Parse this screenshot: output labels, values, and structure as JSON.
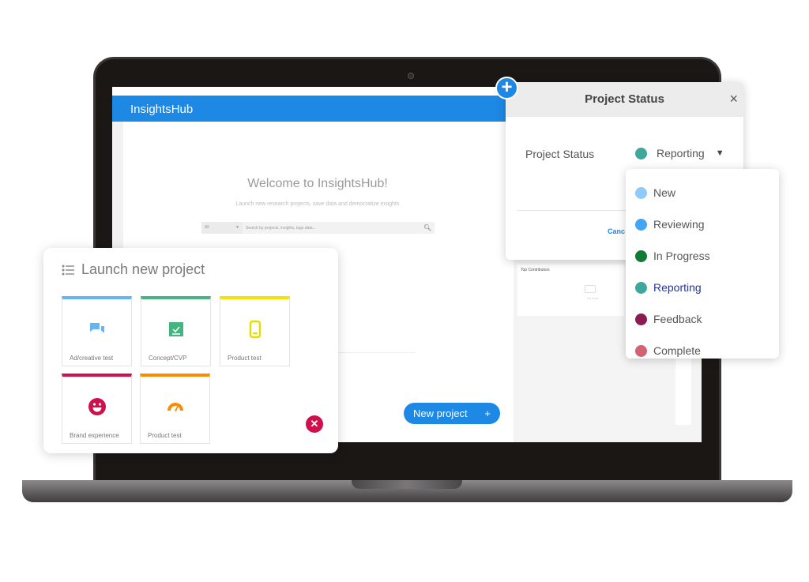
{
  "app": {
    "title": "InsightsHub",
    "welcome": "Welcome to InsightsHub!",
    "subtitle": "Launch new research projects, save data and democratize insights",
    "search": {
      "filter": "All",
      "placeholder": "Search by projects, insights, tags data..."
    },
    "top_contributors": {
      "title": "Top Contributors",
      "empty": "No Data"
    },
    "new_project_label": "New project",
    "new_project_icon": "+",
    "accent": "#1e88e5"
  },
  "launch": {
    "title": "Launch new project",
    "tiles": [
      {
        "label": "Ad/creative test",
        "color": "#64b5f6",
        "icon": "chat-bubbles-icon"
      },
      {
        "label": "Concept/CVP",
        "color": "#43b581",
        "icon": "checkbox-icon"
      },
      {
        "label": "Product test",
        "color": "#f0e400",
        "icon": "phone-icon"
      },
      {
        "label": "Brand experience",
        "color": "#d0104c",
        "icon": "smiley-icon"
      },
      {
        "label": "Product test",
        "color": "#fb8c00",
        "icon": "gauge-icon"
      }
    ],
    "close_icon": "✕"
  },
  "dialog": {
    "title": "Project Status",
    "close": "×",
    "field_label": "Project Status",
    "selected": "Reporting",
    "selected_color": "#3ea99a",
    "cancel": "Canc",
    "add_icon": "+"
  },
  "dropdown": {
    "options": [
      {
        "label": "New",
        "color": "#90caf9"
      },
      {
        "label": "Reviewing",
        "color": "#42a5f5"
      },
      {
        "label": "In Progress",
        "color": "#137a35"
      },
      {
        "label": "Reporting",
        "color": "#3ea99a",
        "selected": true
      },
      {
        "label": "Feedback",
        "color": "#8a1c52"
      },
      {
        "label": "Complete",
        "color": "#d16372"
      }
    ]
  }
}
